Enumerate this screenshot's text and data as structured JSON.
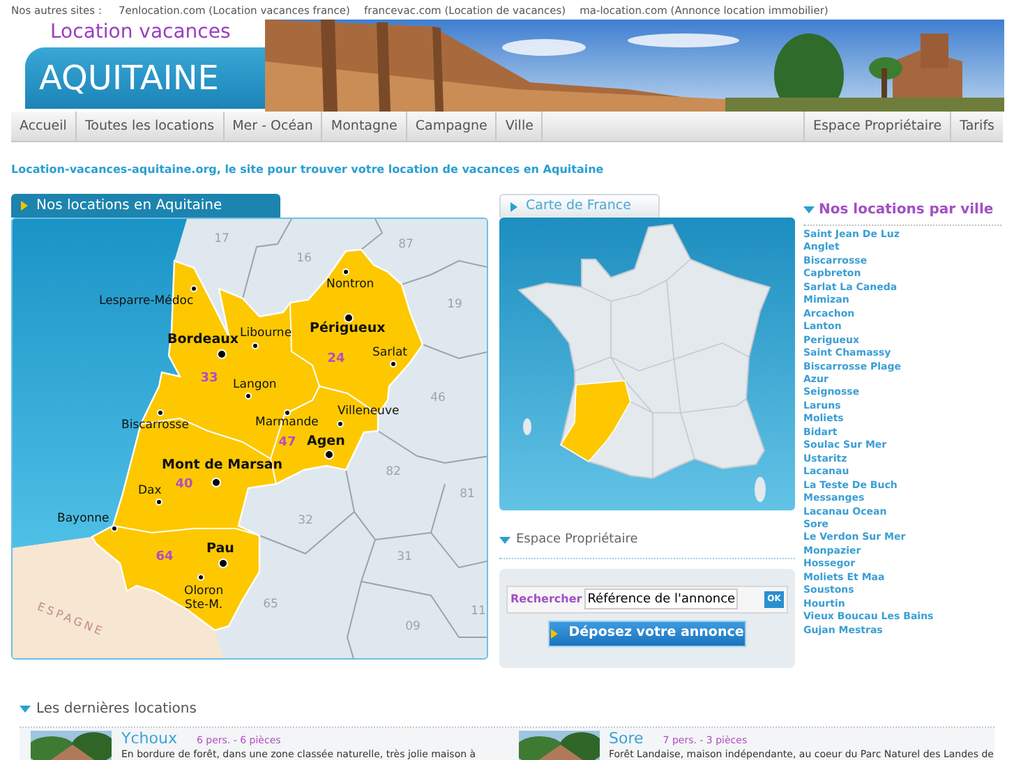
{
  "other_sites": {
    "label": "Nos autres sites :",
    "links": [
      "7enlocation.com (Location vacances france)",
      "francevac.com (Location de vacances)",
      "ma-location.com (Annonce location immobilier)"
    ]
  },
  "logo": {
    "subtitle": "Location vacances",
    "title": "AQUITAINE"
  },
  "nav": {
    "left": [
      "Accueil",
      "Toutes les locations",
      "Mer - Océan",
      "Montagne",
      "Campagne",
      "Ville"
    ],
    "right": [
      "Espace Propriétaire",
      "Tarifs"
    ]
  },
  "tagline": "Location-vacances-aquitaine.org, le site pour trouver votre location de vacances en Aquitaine",
  "region_map": {
    "title": "Nos locations en Aquitaine",
    "towns": [
      {
        "name": "Nontron",
        "kind": "town"
      },
      {
        "name": "Lesparre-Médoc",
        "kind": "town"
      },
      {
        "name": "Périgueux",
        "kind": "prefecture"
      },
      {
        "name": "Libourne",
        "kind": "town"
      },
      {
        "name": "Bordeaux",
        "kind": "prefecture"
      },
      {
        "name": "Sarlat",
        "kind": "town"
      },
      {
        "name": "Langon",
        "kind": "town"
      },
      {
        "name": "Villeneuve",
        "kind": "town"
      },
      {
        "name": "Marmande",
        "kind": "town"
      },
      {
        "name": "Biscarrosse",
        "kind": "town"
      },
      {
        "name": "Agen",
        "kind": "prefecture"
      },
      {
        "name": "Mont de Marsan",
        "kind": "prefecture"
      },
      {
        "name": "Dax",
        "kind": "town"
      },
      {
        "name": "Bayonne",
        "kind": "town"
      },
      {
        "name": "Pau",
        "kind": "prefecture"
      },
      {
        "name": "Oloron\nSte-M.",
        "kind": "town"
      }
    ],
    "aquitaine_codes": [
      "33",
      "24",
      "47",
      "40",
      "64"
    ],
    "other_codes": [
      "17",
      "16",
      "87",
      "19",
      "46",
      "82",
      "81",
      "32",
      "31",
      "65",
      "09",
      "11"
    ],
    "country_label": "ESPAGNE"
  },
  "france_map": {
    "title": "Carte de France"
  },
  "owner_space": {
    "title": "Espace Propriétaire",
    "search_label": "Rechercher",
    "search_value": "Référence de l'annonce",
    "ok_label": "OK",
    "post_button": "Déposez votre annonce"
  },
  "cities": {
    "title": "Nos locations par ville",
    "items": [
      "Saint Jean De Luz",
      "Anglet",
      "Biscarrosse",
      "Capbreton",
      "Sarlat La Caneda",
      "Mimizan",
      "Arcachon",
      "Lanton",
      "Perigueux",
      "Saint Chamassy",
      "Biscarrosse Plage",
      "Azur",
      "Seignosse",
      "Laruns",
      "Moliets",
      "Bidart",
      "Soulac Sur Mer",
      "Ustaritz",
      "Lacanau",
      "La Teste De Buch",
      "Messanges",
      "Lacanau Ocean",
      "Sore",
      "Le Verdon Sur Mer",
      "Monpazier",
      "Hossegor",
      "Moliets Et Maa",
      "Soustons",
      "Hourtin",
      "Vieux Boucau Les Bains",
      "Gujan Mestras"
    ]
  },
  "latest": {
    "title": "Les dernières locations",
    "cards": [
      {
        "name": "Ychoux",
        "details": "6 pers. - 6 pièces",
        "description": "En bordure de forêt, dans une zone classée naturelle, très jolie maison à"
      },
      {
        "name": "Sore",
        "details": "7 pers. - 3 pièces",
        "description": "Forêt Landaise, maison indépendante, au coeur du Parc Naturel des Landes de"
      }
    ]
  }
}
